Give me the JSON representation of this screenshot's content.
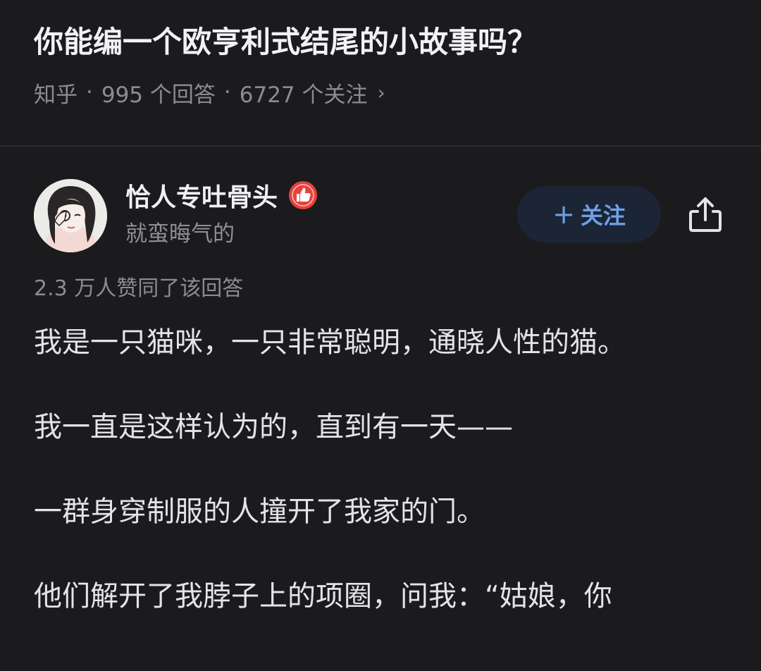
{
  "question": {
    "title": "你能编一个欧亨利式结尾的小故事吗？",
    "source": "知乎",
    "answers": "995 个回答",
    "followers": "6727 个关注"
  },
  "author": {
    "name": "恰人专吐骨头",
    "bio": "就蛮晦气的",
    "follow_label": "关注"
  },
  "answer": {
    "vote_text": "2.3 万人赞同了该回答",
    "paragraphs": [
      "我是一只猫咪，一只非常聪明，通晓人性的猫。",
      "我一直是这样认为的，直到有一天——",
      "一群身穿制服的人撞开了我家的门。",
      "他们解开了我脖子上的项圈，问我：“姑娘，你"
    ]
  },
  "colors": {
    "background": "#1b1b1d",
    "accent": "#6f9ee8",
    "badge": "#e8413d"
  },
  "icons": {
    "meta_more": "chevron-right-icon",
    "badge": "thumbs-up-badge-icon",
    "share": "share-icon",
    "follow": "plus-icon"
  }
}
